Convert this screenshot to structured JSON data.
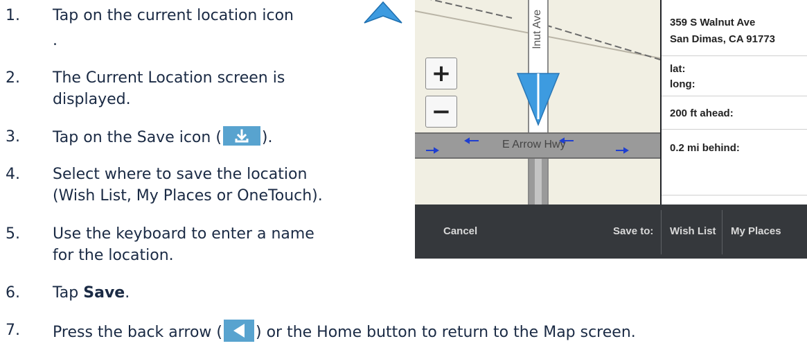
{
  "steps": [
    {
      "n": "1.",
      "text": "Tap on the current location icon",
      "cont": "."
    },
    {
      "n": "2.",
      "text": "The Current Location screen is",
      "cont": "displayed."
    },
    {
      "n": "3.",
      "text_a": "Tap on the Save icon (",
      "text_b": ")."
    },
    {
      "n": "4.",
      "text": "Select where to save the location",
      "cont": "(Wish List, My Places or OneTouch)."
    },
    {
      "n": "5.",
      "text": "Use the keyboard to enter a name",
      "cont": "for the location."
    },
    {
      "n": "6.",
      "text_a": "Tap ",
      "bold": "Save",
      "text_b": "."
    },
    {
      "n": "7.",
      "text_a": "Press the back arrow (",
      "text_b": ") or the Home button to return to the Map screen."
    }
  ],
  "screenshot": {
    "street_vertical": "lnut Ave",
    "street_horizontal": "E Arrow Hwy",
    "zoom_in": "+",
    "zoom_out": "−",
    "address_line1": "359 S Walnut Ave",
    "address_line2": "San Dimas, CA 91773",
    "lat_label": "lat:",
    "long_label": "long:",
    "ahead": "200 ft ahead:",
    "behind": "0.2 mi behind:",
    "cancel": "Cancel",
    "save_to": "Save to:",
    "wish_list": "Wish List",
    "my_places": "My Places"
  },
  "colors": {
    "text": "#1a2a44",
    "icon_blue": "#58a3cf",
    "location_arrow": "#3d9be0",
    "map_bg": "#f1efe3",
    "road_gray": "#9a9a9a",
    "bar_bg": "#35383c"
  }
}
